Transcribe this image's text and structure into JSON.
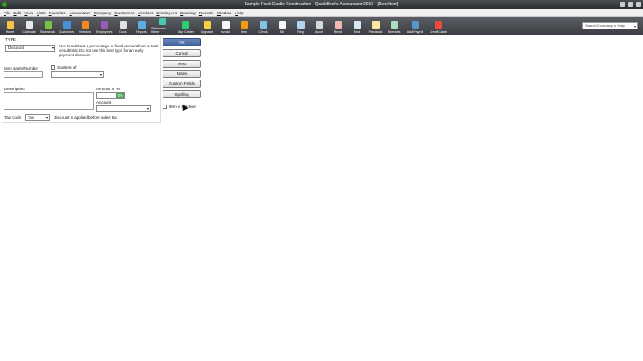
{
  "window": {
    "title": "Sample Rock Castle Construction - QuickBooks Accountant 2013 - [New Item]"
  },
  "menu": [
    "File",
    "Edit",
    "View",
    "Lists",
    "Favorites",
    "Accountant",
    "Company",
    "Customers",
    "Vendors",
    "Employees",
    "Banking",
    "Reports",
    "Window",
    "Help"
  ],
  "toolbar": [
    {
      "label": "Home",
      "icon": "home-icon",
      "color": "#f5c542"
    },
    {
      "label": "Calendar",
      "icon": "calendar-icon",
      "color": "#e8e8e8"
    },
    {
      "label": "Snapshots",
      "icon": "snapshots-icon",
      "color": "#7cc242"
    },
    {
      "label": "Customers",
      "icon": "customers-icon",
      "color": "#4a90d9"
    },
    {
      "label": "Vendors",
      "icon": "vendors-icon",
      "color": "#f08a24"
    },
    {
      "label": "Employees",
      "icon": "employees-icon",
      "color": "#9b59b6"
    },
    {
      "label": "Docs",
      "icon": "docs-icon",
      "color": "#e0e0e0"
    },
    {
      "label": "Reports",
      "icon": "reports-icon",
      "color": "#5dade2"
    },
    {
      "label": "Statement Writer",
      "icon": "statement-writer-icon",
      "color": "#48c9b0"
    },
    {
      "label": "App Center",
      "icon": "app-center-icon",
      "color": "#2ecc71"
    },
    {
      "label": "Upgrade",
      "icon": "upgrade-icon",
      "color": "#f4d03f"
    },
    {
      "label": "Invoice",
      "icon": "invoice-icon",
      "color": "#f7f7f7"
    },
    {
      "label": "Item",
      "icon": "item-icon",
      "color": "#f39c12"
    },
    {
      "label": "Check",
      "icon": "check-icon",
      "color": "#85c1e9"
    },
    {
      "label": "Bill",
      "icon": "bill-icon",
      "color": "#f7f7f7"
    },
    {
      "label": "Reg",
      "icon": "register-icon",
      "color": "#aed6f1"
    },
    {
      "label": "Accnt",
      "icon": "account-icon",
      "color": "#d5dbdb"
    },
    {
      "label": "Rmnd",
      "icon": "reminder-icon",
      "color": "#f5b7b1"
    },
    {
      "label": "Find",
      "icon": "find-icon",
      "color": "#d6eaf8"
    },
    {
      "label": "Feedback",
      "icon": "feedback-icon",
      "color": "#f9e79f"
    },
    {
      "label": "Services",
      "icon": "services-icon",
      "color": "#a9dfbf"
    },
    {
      "label": "Add Payroll",
      "icon": "add-payroll-icon",
      "color": "#5499c7"
    },
    {
      "label": "Credit Cards",
      "icon": "credit-cards-icon",
      "color": "#e74c3c"
    }
  ],
  "search": {
    "placeholder": "Search Company or Help"
  },
  "form": {
    "type_label": "TYPE",
    "type_value": "Discount",
    "type_description": "Use to subtract a percentage or fixed amount from a total or subtotal. Do not use this item type for an early payment discount.",
    "item_name_label": "Item Name/Number",
    "item_name_value": "",
    "subitem_label": "Subitem of",
    "subitem_value": "",
    "description_label": "Description",
    "description_value": "",
    "amount_label": "Amount or %",
    "amount_value": "0%",
    "account_label": "Account",
    "account_value": "",
    "tax_code_label": "Tax Code",
    "tax_code_value": "Tax",
    "tax_note": "Discount is applied before sales tax"
  },
  "buttons": {
    "ok": "OK",
    "cancel": "Cancel",
    "next": "Next",
    "notes": "Notes",
    "custom_fields": "Custom Fields",
    "spelling": "Spelling",
    "inactive_label": "Item is inactive"
  }
}
